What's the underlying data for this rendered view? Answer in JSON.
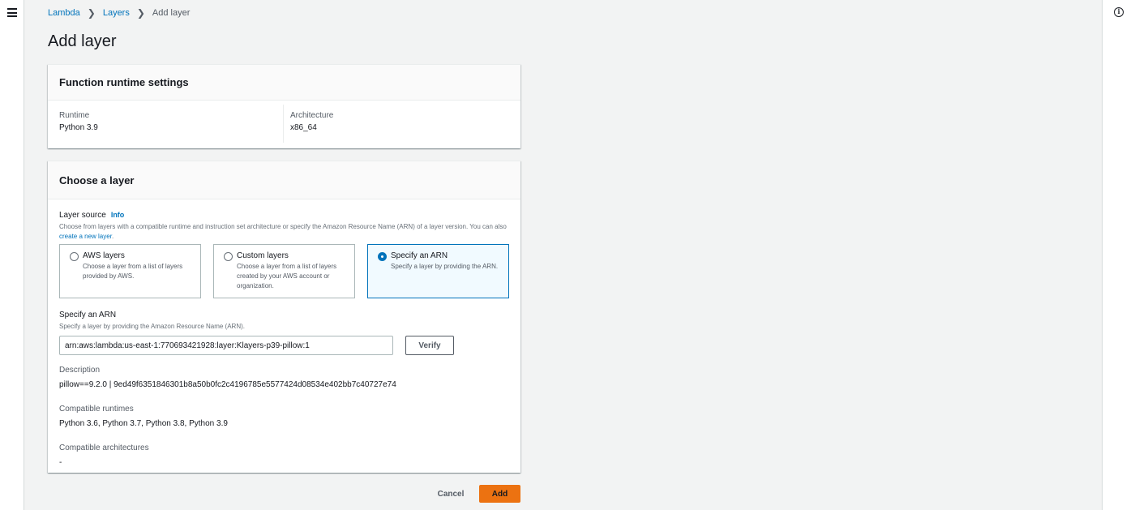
{
  "breadcrumb": {
    "items": [
      "Lambda",
      "Layers"
    ],
    "current": "Add layer"
  },
  "page_title": "Add layer",
  "runtime_panel": {
    "title": "Function runtime settings",
    "runtime_label": "Runtime",
    "runtime_value": "Python 3.9",
    "arch_label": "Architecture",
    "arch_value": "x86_64"
  },
  "layer_panel": {
    "title": "Choose a layer",
    "source_label": "Layer source",
    "info_link": "Info",
    "source_desc": "Choose from layers with a compatible runtime and instruction set architecture or specify the Amazon Resource Name (ARN) of a layer version. You can also",
    "create_link": "create a new layer",
    "tiles": [
      {
        "title": "AWS layers",
        "desc": "Choose a layer from a list of layers provided by AWS.",
        "selected": false
      },
      {
        "title": "Custom layers",
        "desc": "Choose a layer from a list of layers created by your AWS account or organization.",
        "selected": false
      },
      {
        "title": "Specify an ARN",
        "desc": "Specify a layer by providing the ARN.",
        "selected": true
      }
    ],
    "arn_label": "Specify an ARN",
    "arn_desc": "Specify a layer by providing the Amazon Resource Name (ARN).",
    "arn_value": "arn:aws:lambda:us-east-1:770693421928:layer:Klayers-p39-pillow:1",
    "verify_label": "Verify",
    "description_label": "Description",
    "description_value": "pillow==9.2.0 | 9ed49f6351846301b8a50b0fc2c4196785e5577424d08534e402bb7c40727e74",
    "compat_runtimes_label": "Compatible runtimes",
    "compat_runtimes_value": "Python 3.6, Python 3.7, Python 3.8, Python 3.9",
    "compat_arch_label": "Compatible architectures",
    "compat_arch_value": "-"
  },
  "actions": {
    "cancel_label": "Cancel",
    "add_label": "Add"
  },
  "icons": {
    "menu": "hamburger-menu-icon",
    "info": "info-icon",
    "chevron": "chevron-right-icon"
  },
  "colors": {
    "link": "#0073bb",
    "primary_button": "#ec7211",
    "selected_tile_bg": "#f1faff"
  }
}
